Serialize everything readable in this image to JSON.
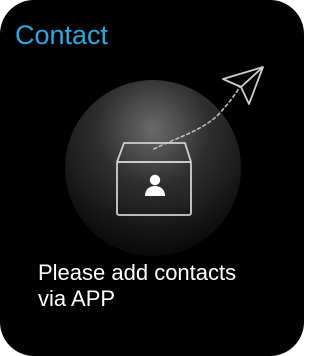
{
  "screen": {
    "title": "Contact",
    "message_lines": [
      "Please add contacts",
      "via APP"
    ],
    "accent_color": "#2EA8E0",
    "text_color": "#FFFFFF",
    "background_color": "#000000"
  },
  "illustration": {
    "icons": [
      "paper-plane-icon",
      "contact-box-icon",
      "person-icon"
    ]
  }
}
